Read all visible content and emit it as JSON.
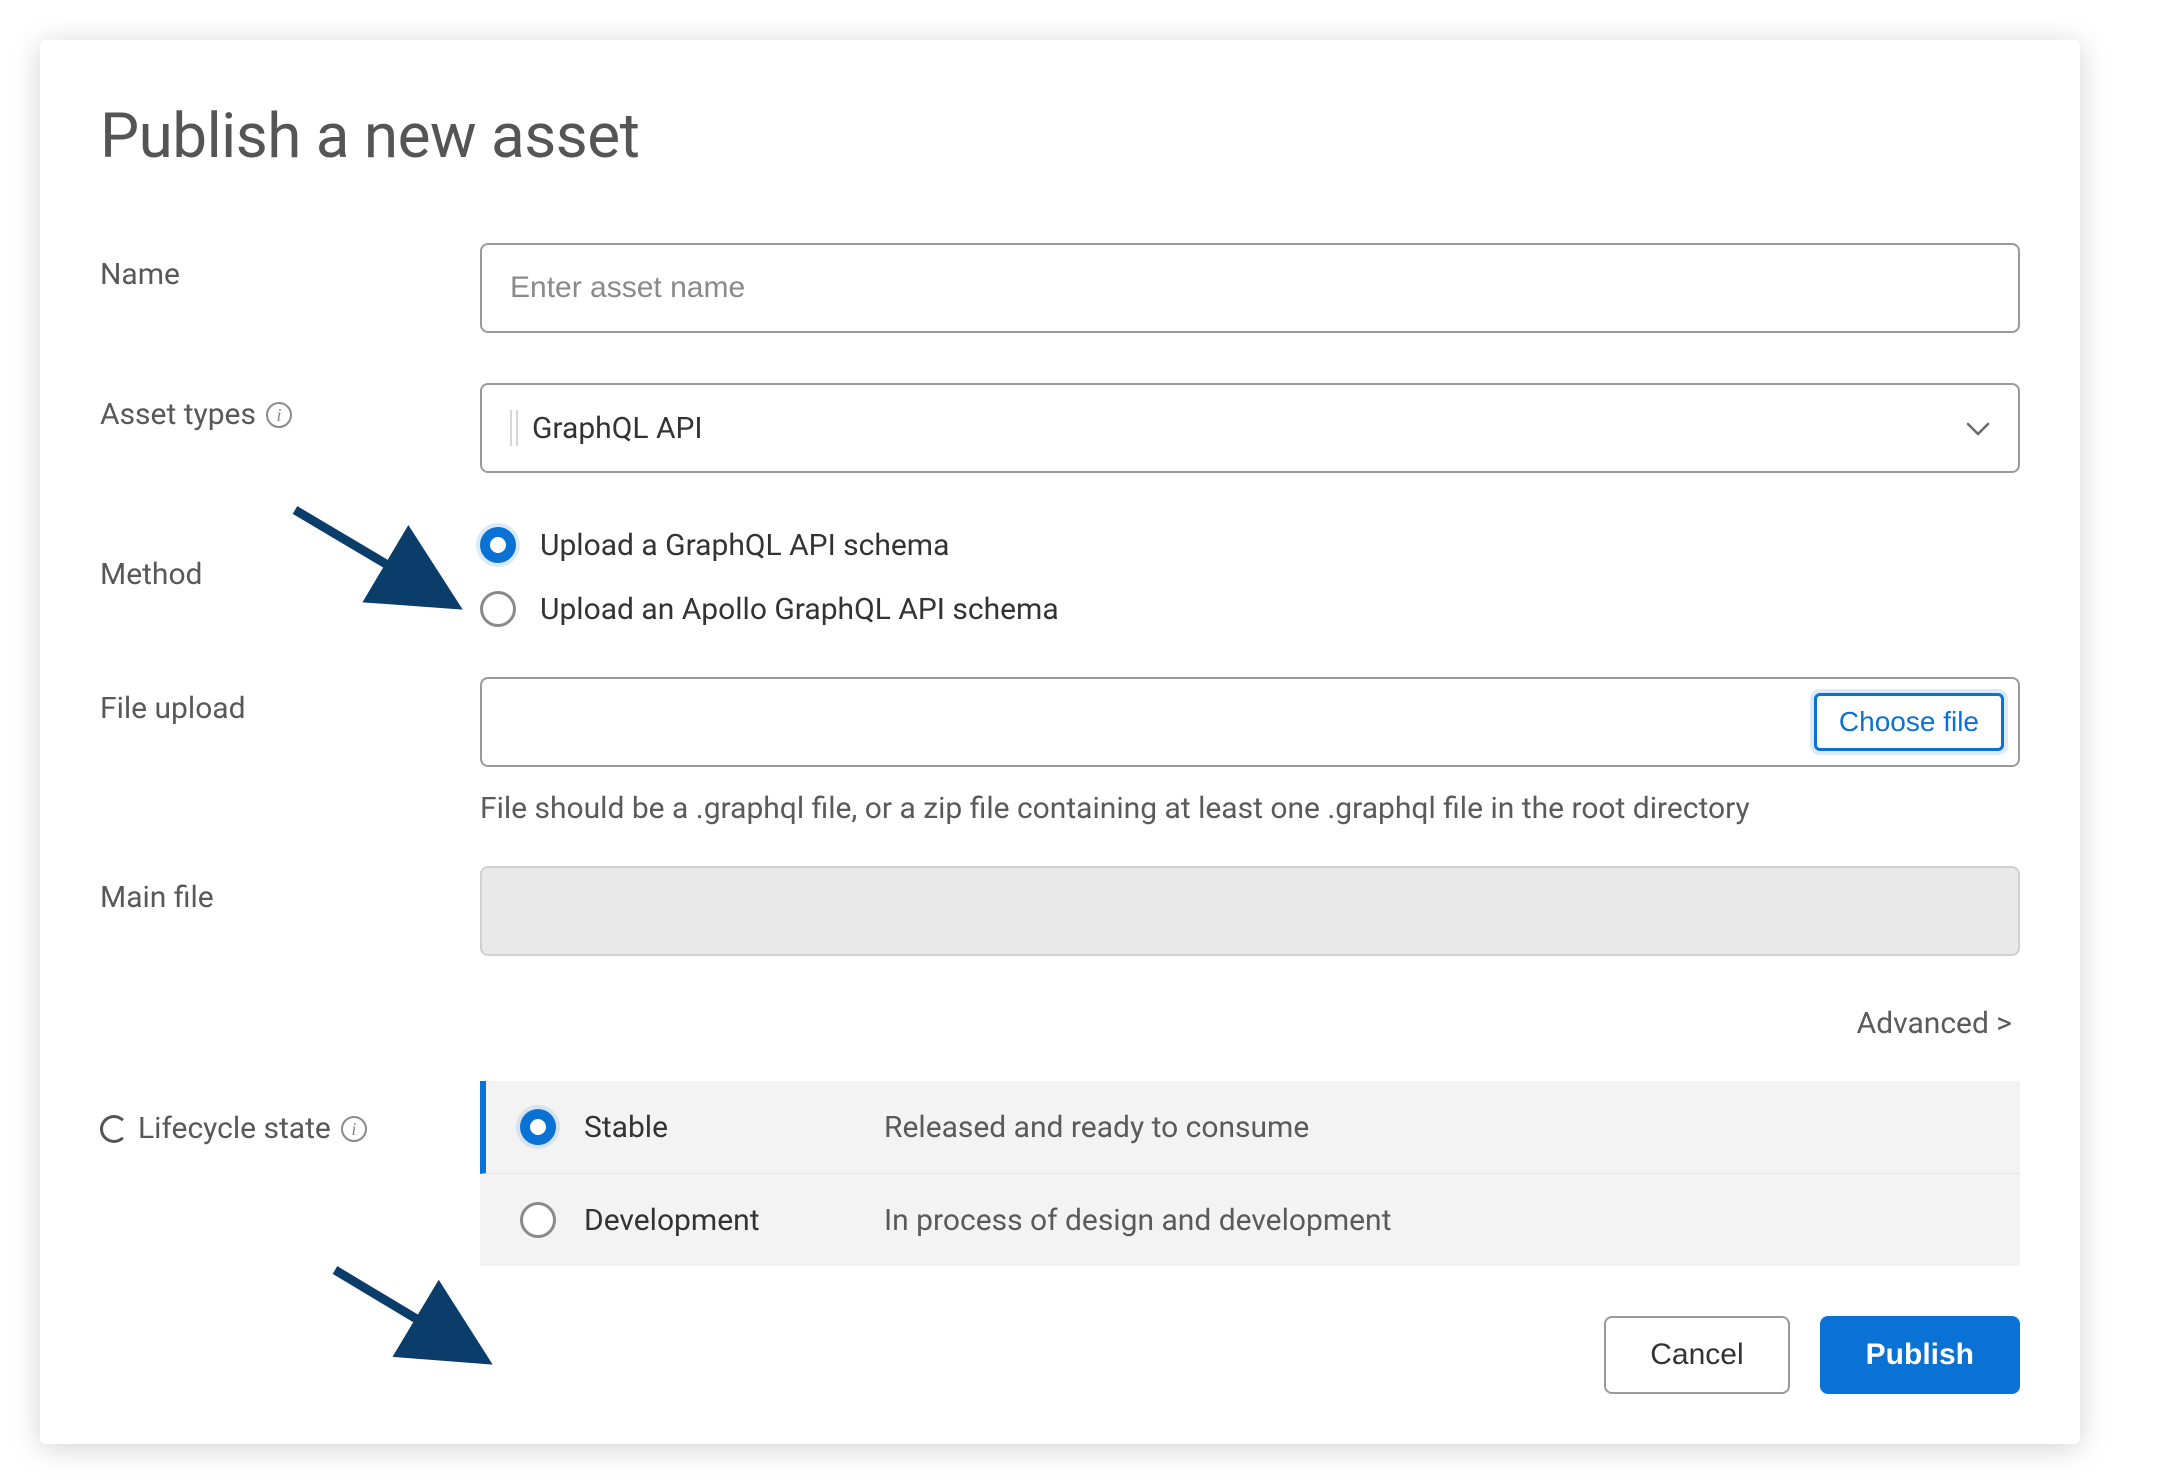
{
  "title": "Publish a new asset",
  "fields": {
    "name": {
      "label": "Name",
      "placeholder": "Enter asset name",
      "value": ""
    },
    "assetTypes": {
      "label": "Asset types",
      "selected": "GraphQL API"
    },
    "method": {
      "label": "Method",
      "options": [
        {
          "label": "Upload a GraphQL API schema",
          "selected": true
        },
        {
          "label": "Upload an Apollo GraphQL API schema",
          "selected": false
        }
      ]
    },
    "fileUpload": {
      "label": "File upload",
      "chooseLabel": "Choose file",
      "hint": "File should be a .graphql file, or a zip file containing at least one .graphql file in the root directory"
    },
    "mainFile": {
      "label": "Main file",
      "value": ""
    },
    "advancedLabel": "Advanced  >",
    "lifecycle": {
      "label": "Lifecycle state",
      "options": [
        {
          "name": "Stable",
          "desc": "Released and ready to consume",
          "selected": true
        },
        {
          "name": "Development",
          "desc": "In process of design and development",
          "selected": false
        }
      ]
    }
  },
  "buttons": {
    "cancel": "Cancel",
    "publish": "Publish"
  }
}
